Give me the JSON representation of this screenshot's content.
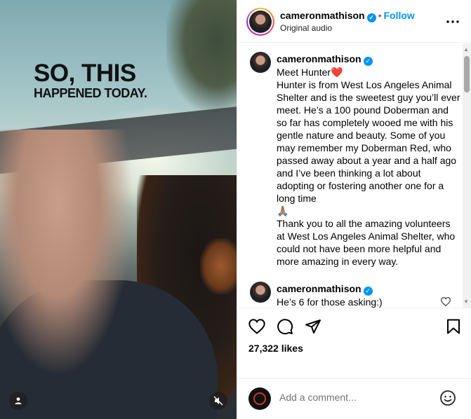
{
  "media": {
    "overlay_line1": "SO, THIS",
    "overlay_line2": "HAPPENED TODAY."
  },
  "header": {
    "username": "cameronmathison",
    "separator": "•",
    "follow_label": "Follow",
    "audio_label": "Original audio",
    "more_icon": "more-horizontal-icon"
  },
  "caption": {
    "username": "cameronmathison",
    "paragraph1": "Meet Hunter",
    "paragraph1_emoji": "❤️",
    "paragraph2": "Hunter is from West Los Angeles Animal Shelter and is the sweetest guy you’ll ever meet. He’s a 100 pound Doberman and so far has completely wooed me with his gentle nature and beauty. Some of you may remember my Doberman Red, who passed away about a year and a half ago and I’ve been thinking a lot about adopting or fostering another one for a long time",
    "paragraph2_emoji": "🙏🏽",
    "paragraph3": "Thank you to all the amazing volunteers at West Los Angeles Animal Shelter, who could not have been more helpful and more amazing in every way."
  },
  "comments": [
    {
      "username": "cameronmathison",
      "text": "He’s 6 for those asking:)"
    }
  ],
  "actions": {
    "likes_count": "27,322",
    "likes_label": "likes"
  },
  "add_comment": {
    "placeholder": "Add a comment..."
  },
  "colors": {
    "accent": "#0095f6",
    "border": "#efefef",
    "muted": "#737373"
  }
}
